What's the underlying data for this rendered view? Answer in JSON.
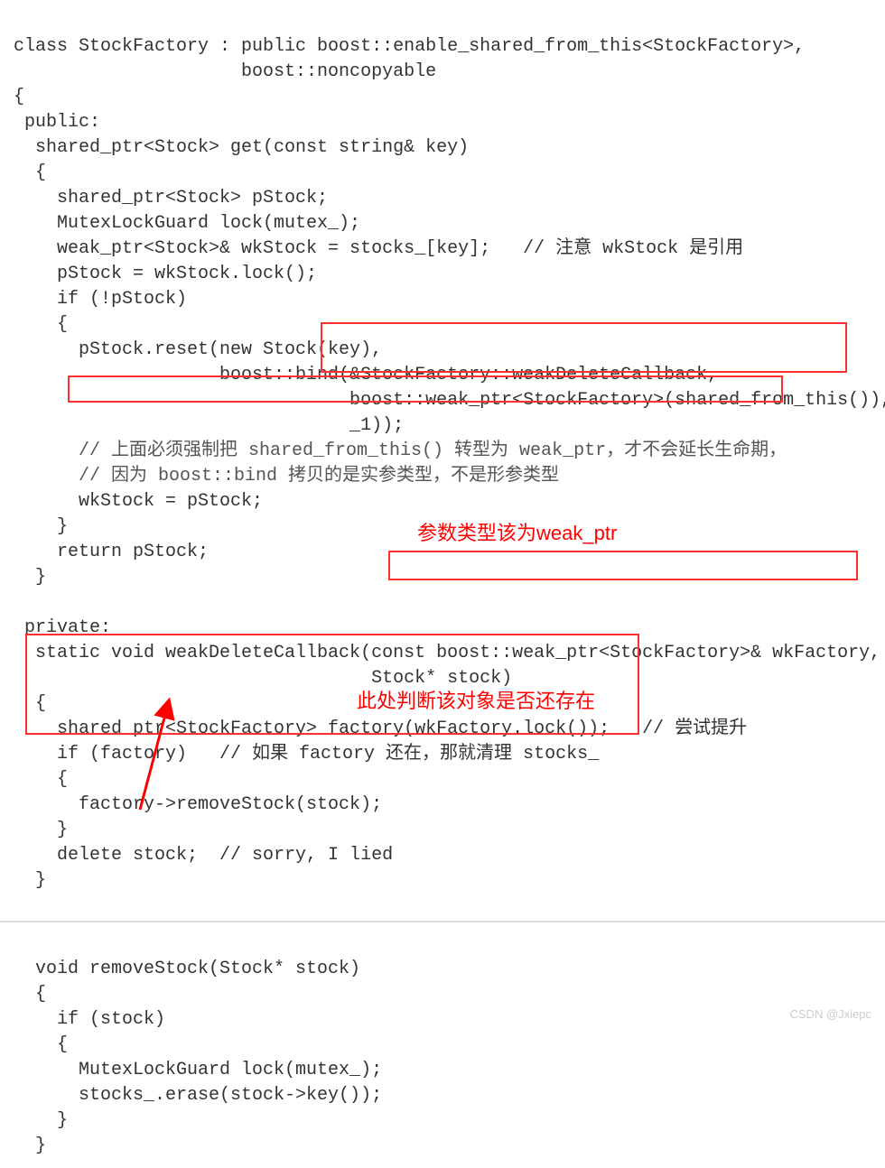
{
  "code1": {
    "l01": "class StockFactory : public boost::enable_shared_from_this<StockFactory>,",
    "l02": "                     boost::noncopyable",
    "l03": "{",
    "l04": " public:",
    "l05": "  shared_ptr<Stock> get(const string& key)",
    "l06": "  {",
    "l07": "    shared_ptr<Stock> pStock;",
    "l08": "    MutexLockGuard lock(mutex_);",
    "l09": "    weak_ptr<Stock>& wkStock = stocks_[key];   // 注意 wkStock 是引用",
    "l10": "    pStock = wkStock.lock();",
    "l11": "    if (!pStock)",
    "l12": "    {",
    "l13": "      pStock.reset(new Stock(key),",
    "l14": "                   boost::bind(&StockFactory::weakDeleteCallback,",
    "l15": "                               boost::weak_ptr<StockFactory>(shared_from_this()),",
    "l16": "                               _1));",
    "l17": "      // 上面必须强制把 shared_from_this() 转型为 weak_ptr，才不会延长生命期，",
    "l18": "      // 因为 boost::bind 拷贝的是实参类型，不是形参类型",
    "l19": "      wkStock = pStock;",
    "l20": "    }",
    "l21": "    return pStock;",
    "l22": "  }",
    "l23": "",
    "l24": " private:",
    "l25": "  static void weakDeleteCallback(const boost::weak_ptr<StockFactory>& wkFactory,",
    "l26": "                                 Stock* stock)",
    "l27": "  {",
    "l28": "    shared_ptr<StockFactory> factory(wkFactory.lock());   // 尝试提升",
    "l29": "    if (factory)   // 如果 factory 还在，那就清理 stocks_",
    "l30": "    {",
    "l31": "      factory->removeStock(stock);",
    "l32": "    }",
    "l33": "    delete stock;  // sorry, I lied",
    "l34": "  }"
  },
  "code2": {
    "l01": "  void removeStock(Stock* stock)",
    "l02": "  {",
    "l03": "    if (stock)",
    "l04": "    {",
    "l05": "      MutexLockGuard lock(mutex_);",
    "l06": "      stocks_.erase(stock->key());",
    "l07": "    }",
    "l08": "  }"
  },
  "annotations": {
    "a1": "参数类型该为weak_ptr",
    "a2": "此处判断该对象是否还存在"
  },
  "watermark": "CSDN @Jxiepc"
}
